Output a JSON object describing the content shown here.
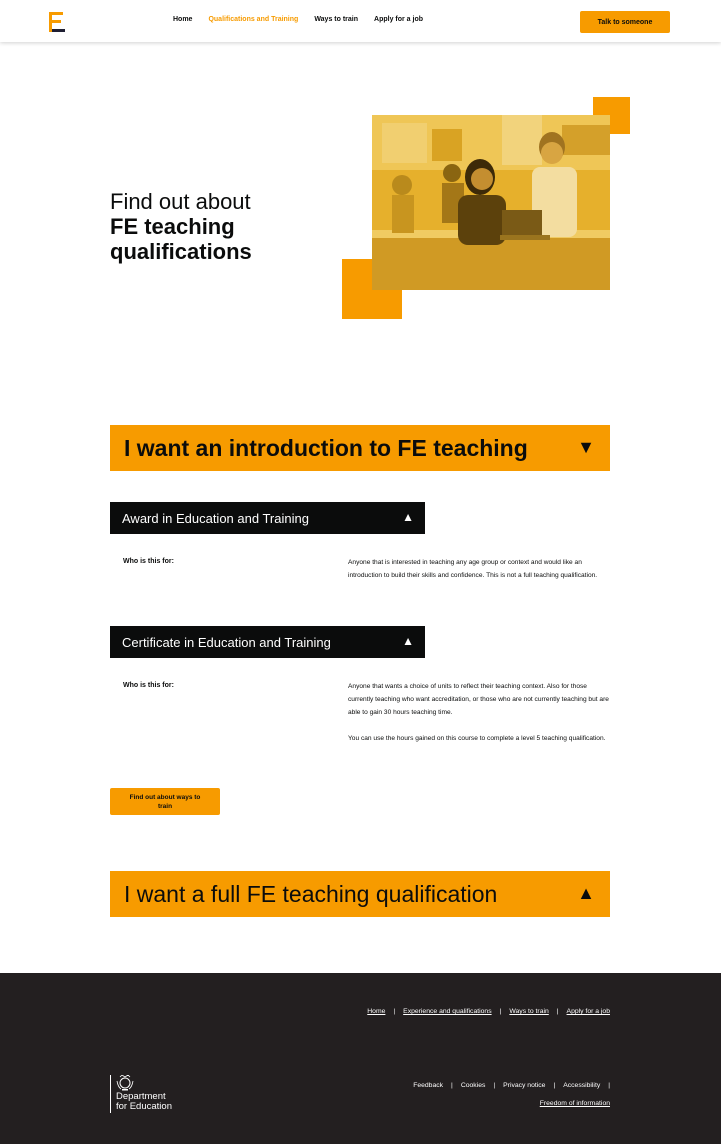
{
  "header": {
    "nav": [
      {
        "label": "Home",
        "active": false
      },
      {
        "label": "Qualifications and Training",
        "active": true
      },
      {
        "label": "Ways to train",
        "active": false
      },
      {
        "label": "Apply for a job",
        "active": false
      }
    ],
    "cta_label": "Talk to someone"
  },
  "hero": {
    "title_light": "Find out about",
    "title_bold_1": "FE teaching",
    "title_bold_2": "qualifications"
  },
  "accordion_intro": {
    "label": "I want an introduction to FE teaching",
    "caret": "▼",
    "items": [
      {
        "title": "Award in Education and Training",
        "caret": "▲",
        "who_label": "Who is this for:",
        "paragraphs": [
          "Anyone that is interested in teaching any age group or context and would like an introduction to build their skills and confidence. This is not a full teaching qualification."
        ]
      },
      {
        "title": "Certificate in Education and Training",
        "caret": "▲",
        "who_label": "Who is this for:",
        "paragraphs": [
          "Anyone that wants a choice of units to reflect their teaching context. Also for those currently teaching who want accreditation, or those who are not currently teaching but are able to gain 30 hours teaching time.",
          "You can use the hours gained on this course to complete a level 5 teaching qualification."
        ]
      }
    ],
    "button_label": "Find out about ways to train"
  },
  "accordion_full": {
    "label": "I want a full FE teaching qualification",
    "caret": "▲"
  },
  "footer": {
    "top_links": [
      "Home",
      "Experience and qualifications",
      "Ways to train",
      "Apply for a job"
    ],
    "bottom_links": [
      "Feedback",
      "Cookies",
      "Privacy notice",
      "Accessibility"
    ],
    "foi_label": "Freedom of information",
    "dfe_line1": "Department",
    "dfe_line2": "for Education"
  },
  "colors": {
    "accent": "#f79b00",
    "dark": "#0b0c0c",
    "footer_bg": "#231f20"
  }
}
